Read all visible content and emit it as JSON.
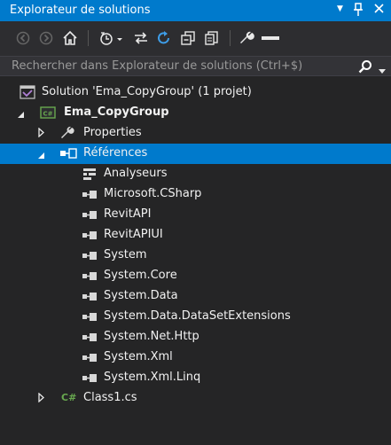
{
  "panel": {
    "title": "Explorateur de solutions",
    "pin_glyph": "▼",
    "close_glyph": "✕"
  },
  "toolbar": {
    "buttons": [
      "back-icon",
      "forward-icon",
      "home-icon",
      "history-icon",
      "sync-icon",
      "refresh-icon",
      "collapse-all-icon",
      "copy-icon",
      "properties-wrench-icon",
      "preview-icon"
    ]
  },
  "search": {
    "placeholder": "Rechercher dans Explorateur de solutions (Ctrl+$)"
  },
  "tree": {
    "solution": "Solution 'Ema_CopyGroup' (1 projet)",
    "project": "Ema_CopyGroup",
    "properties": "Properties",
    "references": "Références",
    "reference_items": [
      "Analyseurs",
      "Microsoft.CSharp",
      "RevitAPI",
      "RevitAPIUI",
      "System",
      "System.Core",
      "System.Data",
      "System.Data.DataSetExtensions",
      "System.Net.Http",
      "System.Xml",
      "System.Xml.Linq"
    ],
    "class_file": "Class1.cs",
    "csharp_badge": "C#"
  },
  "colors": {
    "accent": "#007acc",
    "background": "#252526",
    "text": "#f1f1f1",
    "project_icon_green": "#68a84f"
  }
}
